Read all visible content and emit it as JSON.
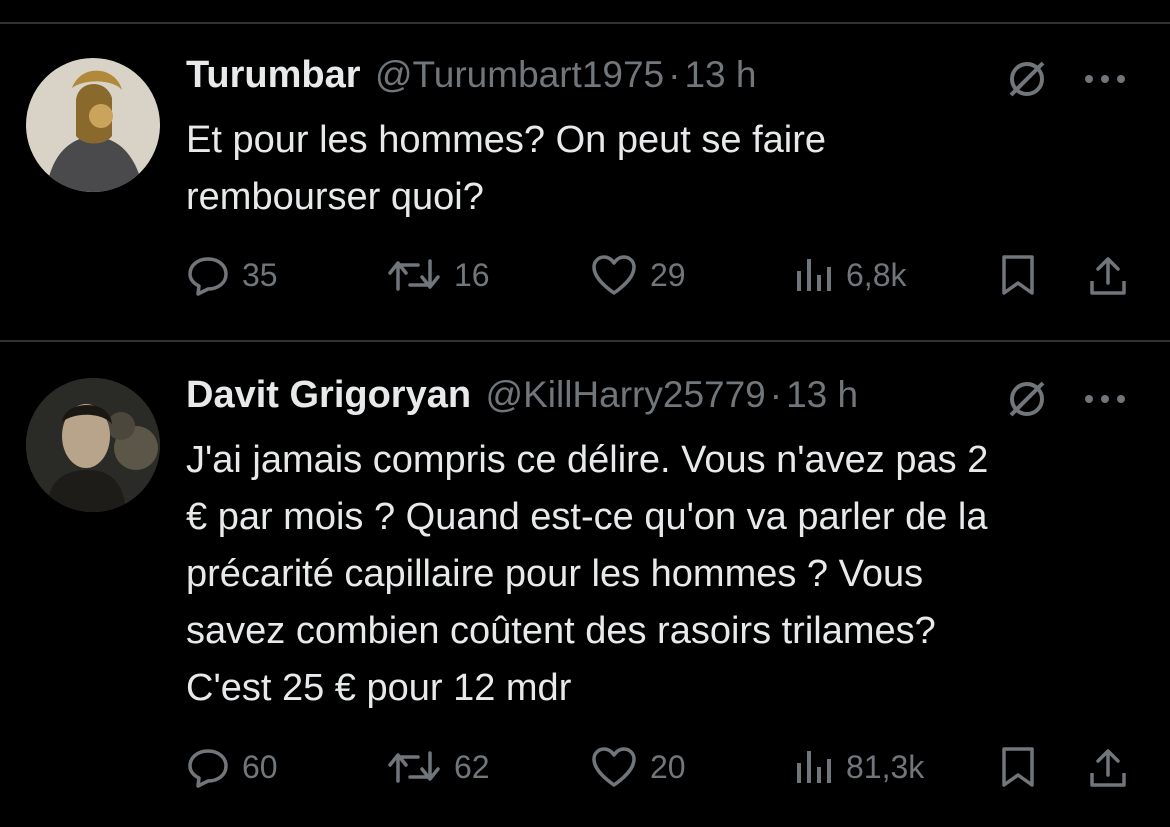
{
  "tweets": [
    {
      "name": "Turumbar",
      "handle": "@Turumbart1975",
      "separator": "·",
      "time": "13 h",
      "lines": [
        "Et pour les hommes? On peut se faire",
        "rembourser quoi?"
      ],
      "replies": "35",
      "retweets": "16",
      "likes": "29",
      "views": "6,8k"
    },
    {
      "name": "Davit Grigoryan",
      "handle": "@KillHarry25779",
      "separator": "·",
      "time": "13 h",
      "lines": [
        "J'ai jamais compris ce délire. Vous n'avez pas 2",
        "€ par mois ? Quand est-ce qu'on va parler de la",
        "précarité capillaire pour les hommes ? Vous",
        "savez combien coûtent des rasoirs trilames?",
        "C'est 25 € pour 12 mdr"
      ],
      "replies": "60",
      "retweets": "62",
      "likes": "20",
      "views": "81,3k"
    }
  ],
  "icons": [
    "reply-icon",
    "retweet-icon",
    "like-icon",
    "views-icon",
    "bookmark-icon",
    "share-icon",
    "grok-icon",
    "more-icon"
  ],
  "colors": {
    "background": "#000000",
    "text": "#e7e9ea",
    "muted": "#71767b",
    "divider": "#2f3336"
  }
}
